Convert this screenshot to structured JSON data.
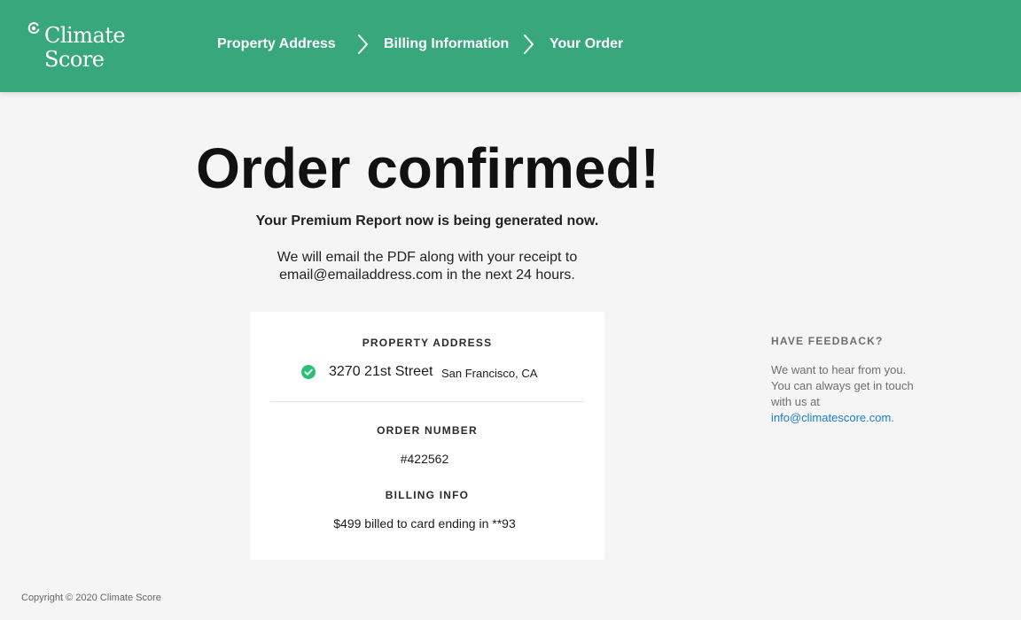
{
  "brand": {
    "name_line1": "Climate",
    "name_line2": "Score",
    "icon": "climate-score-logo-mark"
  },
  "nav": {
    "steps": [
      {
        "label": "Property Address"
      },
      {
        "label": "Billing Information"
      },
      {
        "label": "Your Order"
      }
    ],
    "separator_icon": "chevron-right-icon"
  },
  "confirmation": {
    "title": "Order confirmed!",
    "subtitle": "Your Premium Report now is being generated now.",
    "message_line1": "We will email the PDF along with your receipt to",
    "message_line2": "email@emailaddress.com in the next 24 hours."
  },
  "order_card": {
    "property_label": "PROPERTY ADDRESS",
    "street": "3270 21st Street",
    "city": "San Francisco, CA",
    "status_icon": "check-circle-icon",
    "order_number_label": "ORDER NUMBER",
    "order_number": "#422562",
    "billing_label": "BILLING INFO",
    "billing_value": "$499 billed to card ending in **93"
  },
  "feedback": {
    "title": "HAVE FEEDBACK?",
    "text": "We want to hear from you. You can always get in touch with us at",
    "email_link": "info@climatescore.com",
    "trailing": "."
  },
  "footer": {
    "copyright": "Copyright © 2020 Climate Score"
  },
  "colors": {
    "header": "#38a87c",
    "check": "#2bbf78",
    "link": "#1a7fd0",
    "background": "#f5f5f5"
  }
}
